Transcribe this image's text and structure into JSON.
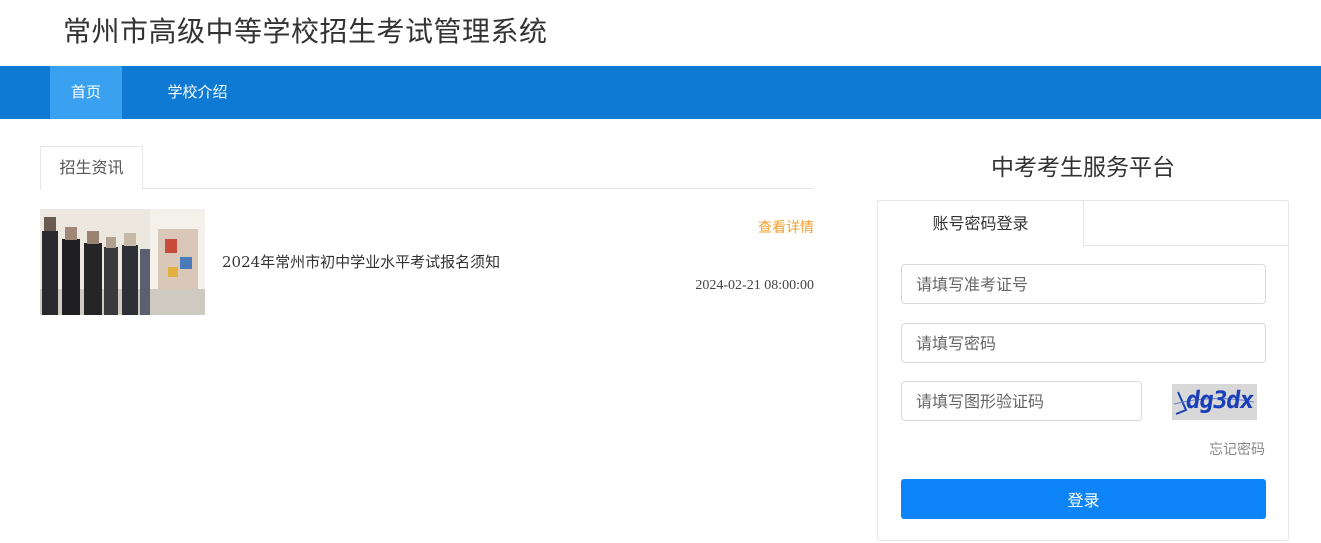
{
  "header": {
    "site_title": "常州市高级中等学校招生考试管理系统"
  },
  "nav": {
    "items": [
      {
        "label": "首页",
        "active": true
      },
      {
        "label": "学校介绍",
        "active": false
      }
    ],
    "bar_color": "#0e7ad3",
    "active_color": "#3aa0f0"
  },
  "news": {
    "tab_label": "招生资讯",
    "items": [
      {
        "title": "2024年常州市初中学业水平考试报名须知",
        "more_label": "查看详情",
        "date": "2024-02-21 08:00:00",
        "thumbnail": "photo-thumbnail"
      }
    ]
  },
  "login": {
    "platform_title": "中考考生服务平台",
    "tab_label": "账号密码登录",
    "exam_id_placeholder": "请填写准考证号",
    "password_placeholder": "请填写密码",
    "captcha_placeholder": "请填写图形验证码",
    "captcha_text": "dg3dx",
    "forgot_label": "忘记密码",
    "submit_label": "登录",
    "accent_color": "#0d85f8"
  }
}
